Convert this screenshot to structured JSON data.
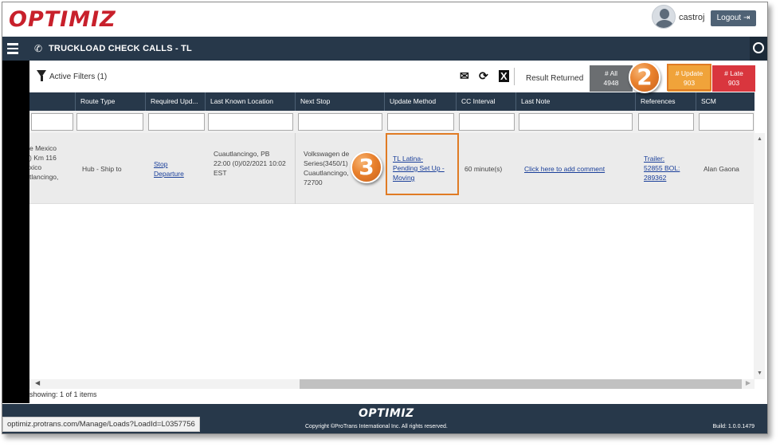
{
  "app": {
    "logo": "OPTIMIZ",
    "username": "castroj",
    "logout_label": "Logout"
  },
  "nav": {
    "page_title": "TRUCKLOAD CHECK CALLS - TL"
  },
  "toolbar": {
    "active_filters": "Active Filters (1)",
    "result_label": "Result Returned",
    "counts": {
      "all": {
        "label": "# All",
        "value": "4948",
        "color": "#6b6e71"
      },
      "update": {
        "label": "# Update",
        "value": "903",
        "color": "#f0a33a"
      },
      "late": {
        "label": "# Late",
        "value": "903",
        "color": "#d9363e"
      }
    }
  },
  "table": {
    "columns": [
      "",
      "Route Type",
      "Required Upd...",
      "Last Known Location",
      "Next Stop",
      "Update Method",
      "CC Interval",
      "Last Note",
      "References",
      "SCM"
    ],
    "row": {
      "origin": [
        "e Mexico",
        ") Km 116",
        "xico",
        "tlancingo,"
      ],
      "route_type": "Hub - Ship to",
      "required_update": [
        "Stop",
        "Departure"
      ],
      "last_known_location": [
        "Cuautlancingo, PB",
        "22:00 (0)/02/2021 10:02",
        "EST"
      ],
      "next_stop": [
        "Volkswagen de",
        "Series(3450/1)",
        "Cuautlancingo,",
        "72700"
      ],
      "update_method": [
        "TL Latina-",
        "Pending Set Up -",
        "Moving"
      ],
      "cc_interval": "60 minute(s)",
      "last_note": "Click here to add comment",
      "references": [
        "Trailer:",
        "52855 BOL:",
        "289362"
      ],
      "scm": "Alan Gaona"
    }
  },
  "showing_text": "showing: 1 of 1 items",
  "footer": {
    "logo": "OPTIMIZ",
    "copyright": "Copyright ©ProTrans International Inc. All rights reserved.",
    "build": "Build: 1.0.0.1479",
    "status_url": "optimiz.protrans.com/Manage/Loads?LoadId=L0357756"
  },
  "callouts": {
    "step2": "2",
    "step3": "3"
  },
  "colors": {
    "navy": "#27384a",
    "accent_orange": "#e07b24",
    "brand_red": "#c8202b"
  }
}
